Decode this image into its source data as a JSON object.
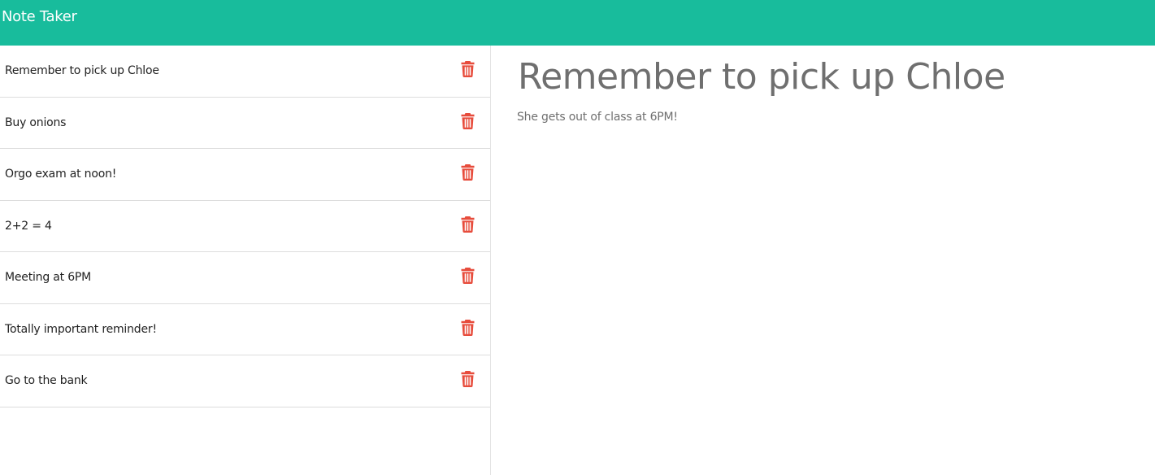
{
  "app": {
    "title": "Note Taker"
  },
  "notes": [
    {
      "title": "Remember to pick up Chloe",
      "delete_icon": "trash-icon"
    },
    {
      "title": "Buy onions",
      "delete_icon": "trash-icon"
    },
    {
      "title": "Orgo exam at noon!",
      "delete_icon": "trash-icon"
    },
    {
      "title": "2+2 = 4",
      "delete_icon": "trash-icon"
    },
    {
      "title": "Meeting at 6PM",
      "delete_icon": "trash-icon"
    },
    {
      "title": "Totally important reminder!",
      "delete_icon": "trash-icon"
    },
    {
      "title": "Go to the bank",
      "delete_icon": "trash-icon"
    }
  ],
  "active_note": {
    "title": "Remember to pick up Chloe",
    "text": "She gets out of class at 6PM!"
  },
  "colors": {
    "navbar": "#18bc9c",
    "delete_icon": "#e74c3c",
    "active_note_text": "#6f6f6f"
  }
}
